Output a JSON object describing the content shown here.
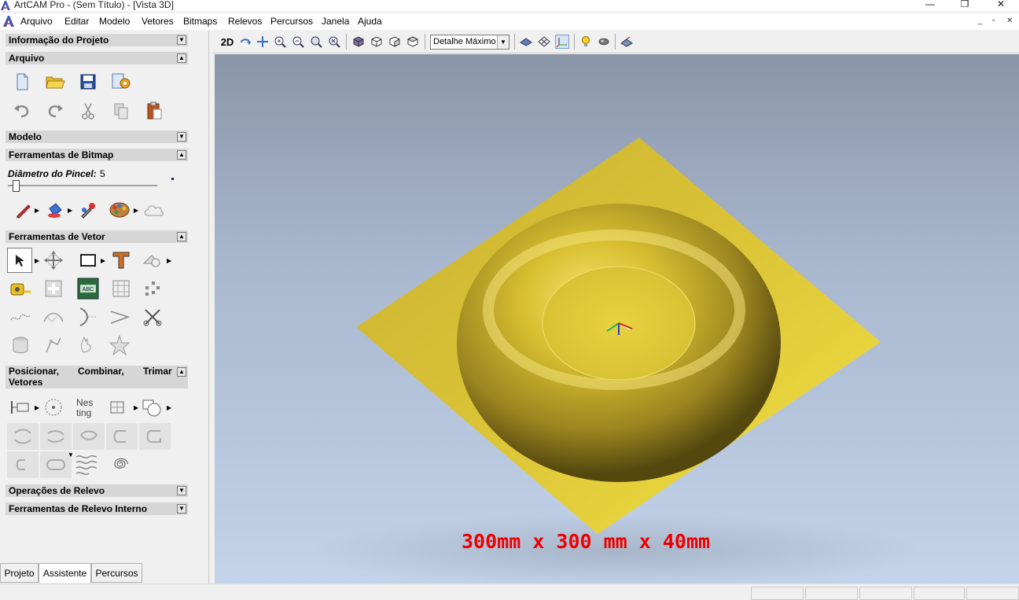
{
  "window": {
    "title": "ArtCAM Pro - (Sem Título) - [Vista 3D]",
    "minimize": "—",
    "restore": "❐",
    "close": "✕"
  },
  "menu": {
    "items": [
      "Arquivo",
      "Editar",
      "Modelo",
      "Vetores",
      "Bitmaps",
      "Relevos",
      "Percursos",
      "Janela",
      "Ajuda"
    ],
    "mdi_minimize": "_",
    "mdi_restore": "▫",
    "mdi_close": "✕"
  },
  "panel": {
    "sections": {
      "projeto": {
        "label": "Informação do Projeto",
        "arrow": "▼"
      },
      "arquivo": {
        "label": "Arquivo",
        "arrow": "▲"
      },
      "modelo": {
        "label": "Modelo",
        "arrow": "▼"
      },
      "bitmap": {
        "label": "Ferramentas de Bitmap",
        "arrow": "▲"
      },
      "vetor": {
        "label": "Ferramentas de Vetor",
        "arrow": "▲"
      },
      "posicionar_a": "Posicionar,",
      "posicionar_b": "Combinar,",
      "posicionar_c": "Trimar",
      "posicionar_d": "Vetores",
      "posicionar_arrow": "▲",
      "relevo": {
        "label": "Operações de Relevo",
        "arrow": "▼"
      },
      "relevo_interno": {
        "label": "Ferramentas de Relevo Interno",
        "arrow": "▼"
      }
    },
    "brush": {
      "label": "Diâmetro do Pincel:",
      "value": "5",
      "slider_fraction": 0.03
    },
    "tabs": [
      "Projeto",
      "Assistente",
      "Percursos"
    ],
    "active_tab": "Assistente",
    "icons": {
      "arquivo": [
        "new-document-icon",
        "open-folder-icon",
        "save-icon",
        "properties-icon",
        "undo-icon",
        "redo-icon",
        "cut-icon",
        "copy-icon",
        "paste-icon"
      ],
      "bitmap": [
        "pencil-icon",
        "paint-bucket-icon",
        "eyedropper-icon",
        "palette-icon",
        "cloud-icon"
      ],
      "vetor": [
        "select-arrow-icon",
        "transform-icon",
        "rectangle-icon",
        "text-tool-icon",
        "shapes-icon",
        "measure-tape-icon",
        "node-edit-icon",
        "abc-text-icon",
        "grid-vector-icon",
        "scatter-icon",
        "smooth-icon",
        "fit-curve-icon",
        "arc-icon",
        "angle-icon",
        "scissors-icon",
        "cylinder-icon",
        "offset-vector-icon",
        "hand-icon",
        "star-icon"
      ],
      "posicionar": [
        "align-icon",
        "circle-dots-icon",
        "nesting-icon",
        "merge-icon",
        "weld-icon",
        "shape-a-icon",
        "shape-b-icon",
        "shape-c-icon",
        "shape-d-icon",
        "shape-e-icon",
        "shape-f-icon",
        "shape-g-icon",
        "wave-icon",
        "spiral-icon"
      ]
    }
  },
  "view": {
    "toolbar_2d": "2D",
    "detail_select": "Detalhe Máximo",
    "dimensions_label": "300mm x 300 mm x 40mm",
    "colors": {
      "relief_gold": "#d9c030",
      "relief_dark": "#6e5e16",
      "background_top": "#8a95a8",
      "background_bottom": "#c3d3ea",
      "label_red": "#ee0000"
    }
  }
}
